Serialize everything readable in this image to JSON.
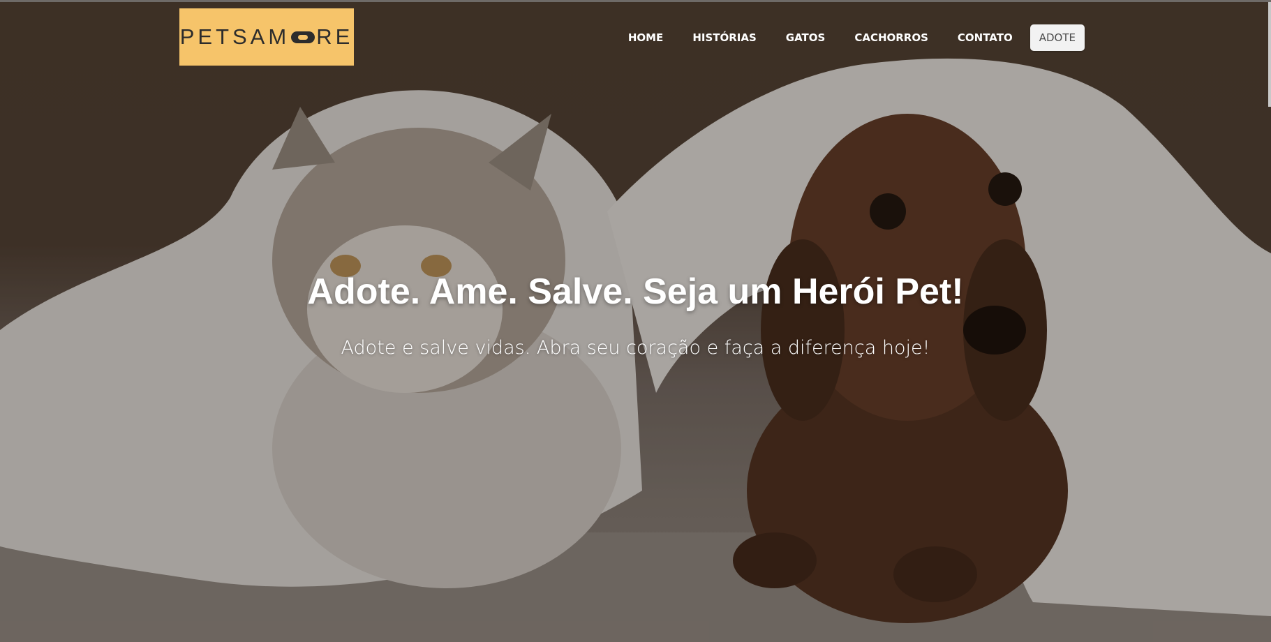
{
  "brand": {
    "logo_text_left": "PETSAM",
    "logo_text_right": "RE",
    "logo_bg_color": "#f6c46a"
  },
  "nav": {
    "items": [
      {
        "label": "HOME"
      },
      {
        "label": "HISTÓRIAS"
      },
      {
        "label": "GATOS"
      },
      {
        "label": "CACHORROS"
      },
      {
        "label": "CONTATO"
      }
    ],
    "cta_label": "ADOTE"
  },
  "hero": {
    "title": "Adote. Ame. Salve. Seja um Herói Pet!",
    "subtitle": "Adote e salve vidas. Abra seu coração e faça a diferença hoje!",
    "image_subject": "cat-and-dachshund-under-blanket"
  }
}
